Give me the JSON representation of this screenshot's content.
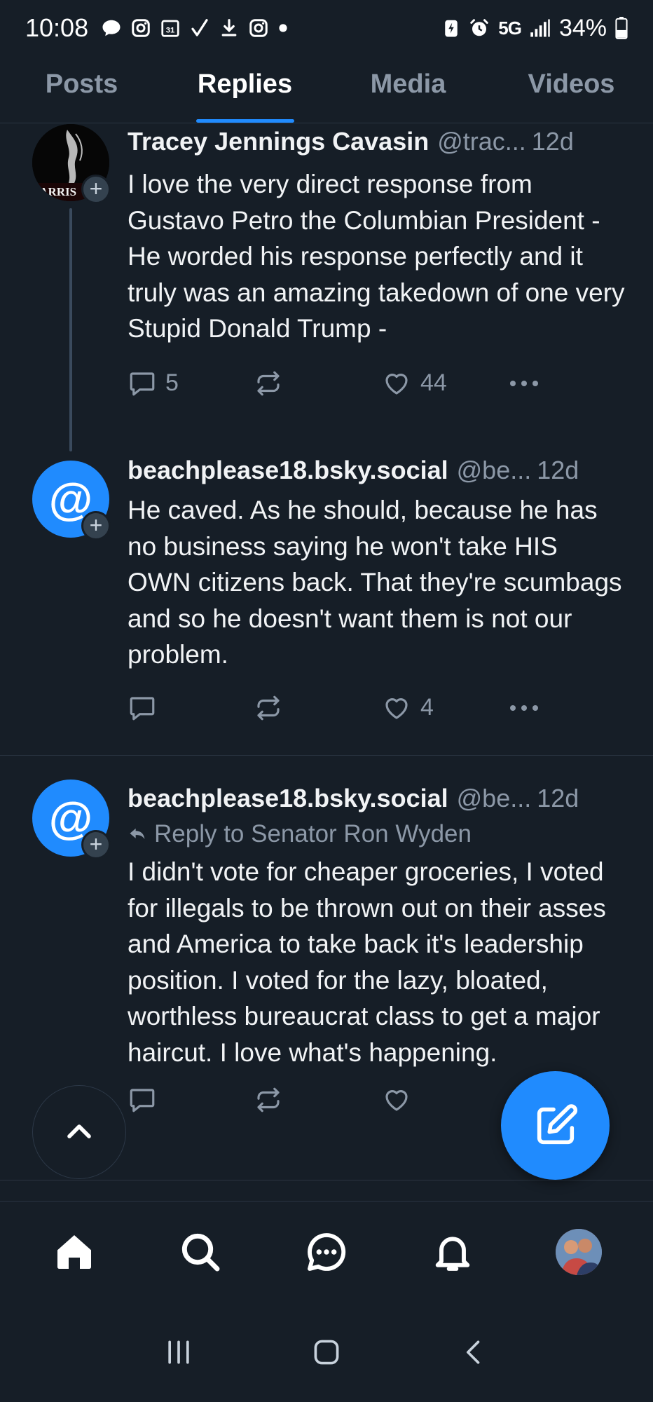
{
  "status_bar": {
    "time": "10:08",
    "network": "5G",
    "battery": "34%"
  },
  "tabs": [
    {
      "label": "Posts",
      "active": false
    },
    {
      "label": "Replies",
      "active": true
    },
    {
      "label": "Media",
      "active": false
    },
    {
      "label": "Videos",
      "active": false
    }
  ],
  "posts": [
    {
      "author": "Tracey Jennings Cavasin",
      "handle": "@trac...",
      "time": "12d",
      "avatar_text": "HARRIS",
      "text": "I love the very direct response from Gustavo Petro the Columbian President - He worded his response perfectly and it truly was an amazing takedown of one very Stupid Donald Trump -",
      "reply_count": "5",
      "repost_count": "",
      "like_count": "44"
    },
    {
      "author": "beachplease18.bsky.social",
      "handle": "@be...",
      "time": "12d",
      "avatar_text": "@",
      "text": "He caved. As he should, because he has no business saying he won't take HIS OWN citizens back. That they're scumbags and so he doesn't want them is not our problem.",
      "reply_count": "",
      "repost_count": "",
      "like_count": "4"
    },
    {
      "author": "beachplease18.bsky.social",
      "handle": "@be...",
      "time": "12d",
      "avatar_text": "@",
      "reply_to": "Reply to Senator Ron Wyden",
      "text": "I didn't vote for cheaper groceries, I voted for illegals to be thrown out on their asses and America to take back it's leadership position. I voted for the lazy, bloated, worthless bureaucrat class to get a major haircut. I love what's happening.",
      "reply_count": "",
      "repost_count": "",
      "like_count": ""
    }
  ],
  "plus_badge": "+",
  "colors": {
    "background": "#161e27",
    "accent": "#208bfe",
    "muted_text": "#8c98a7",
    "divider": "#2a3441"
  },
  "icons": {
    "reply": "speech-bubble-icon",
    "repost": "repost-icon",
    "like": "heart-icon",
    "more": "ellipsis-icon",
    "compose": "compose-icon",
    "scroll_top": "chevron-up-icon",
    "nav": [
      "home-icon",
      "search-icon",
      "chat-icon",
      "bell-icon",
      "profile-avatar"
    ]
  }
}
